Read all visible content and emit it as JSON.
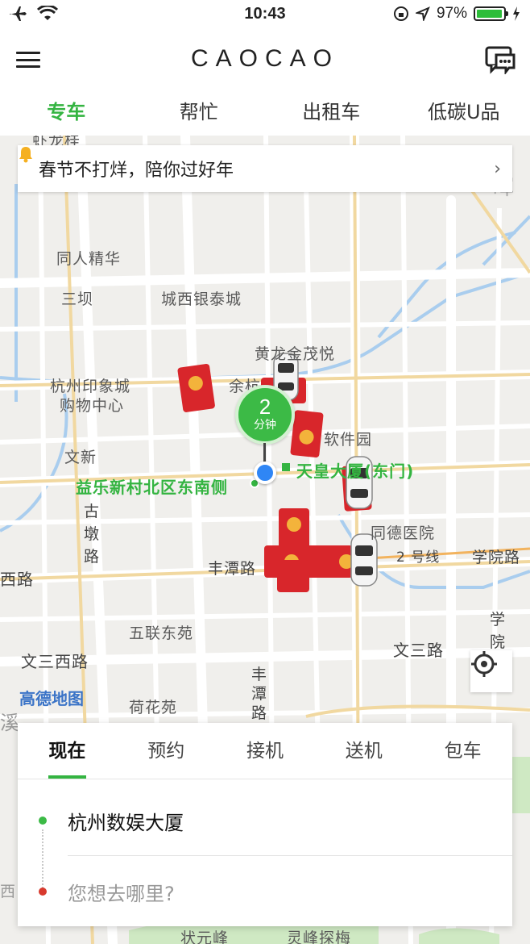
{
  "status_bar": {
    "time": "10:43",
    "battery": "97%",
    "battery_level": 0.97
  },
  "header": {
    "logo": "CAOCAO"
  },
  "service_tabs": [
    {
      "label": "专车",
      "active": true
    },
    {
      "label": "帮忙",
      "active": false
    },
    {
      "label": "出租车",
      "active": false
    },
    {
      "label": "低碳U品",
      "active": false
    }
  ],
  "notice": {
    "text": "春节不打烊，陪你过好年",
    "chevron": "›"
  },
  "map": {
    "eta": {
      "value": "2",
      "unit": "分钟"
    },
    "pickup_label": "益乐新村北区东南侧",
    "dest_hint": "天皇大厦(东门)",
    "provider": "高德地图",
    "places": {
      "top": "虾龙桂",
      "tongren": "同人精华",
      "sanba": "三坝",
      "chengxi": "城西银泰城",
      "huanglong": "黄龙金茂悦",
      "yinxiang1": "杭州印象城",
      "yinxiang2": "购物中心",
      "yuhang": "余杭",
      "wenxin": "文新",
      "ruanjian": "软件园",
      "tongde": "同德医院",
      "gudun": "古墩路",
      "xilu": "西路",
      "fengtan": "丰潭路",
      "line2": "2 号线",
      "xueyuan": "学院路",
      "wulian": "五联东苑",
      "xueyuan_v": "学院",
      "wensanxi": "文三西路",
      "wensan": "文三路",
      "fengtan_v": "丰潭路",
      "hehua": "荷花苑",
      "zhuangyuan": "状元峰",
      "lingfeng": "灵峰探梅",
      "hun": "晖",
      "xi": "溪",
      "xilu2": "西"
    }
  },
  "time_tabs": [
    {
      "label": "现在",
      "active": true
    },
    {
      "label": "预约",
      "active": false
    },
    {
      "label": "接机",
      "active": false
    },
    {
      "label": "送机",
      "active": false
    },
    {
      "label": "包车",
      "active": false
    }
  ],
  "pickup": {
    "value": "杭州数娱大厦",
    "color": "#3cba46"
  },
  "destination": {
    "placeholder": "您想去哪里?",
    "color": "#d83a2e"
  },
  "colors": {
    "accent": "#34b441",
    "red_packet": "#d8262b",
    "user_dot": "#2f86f5"
  }
}
